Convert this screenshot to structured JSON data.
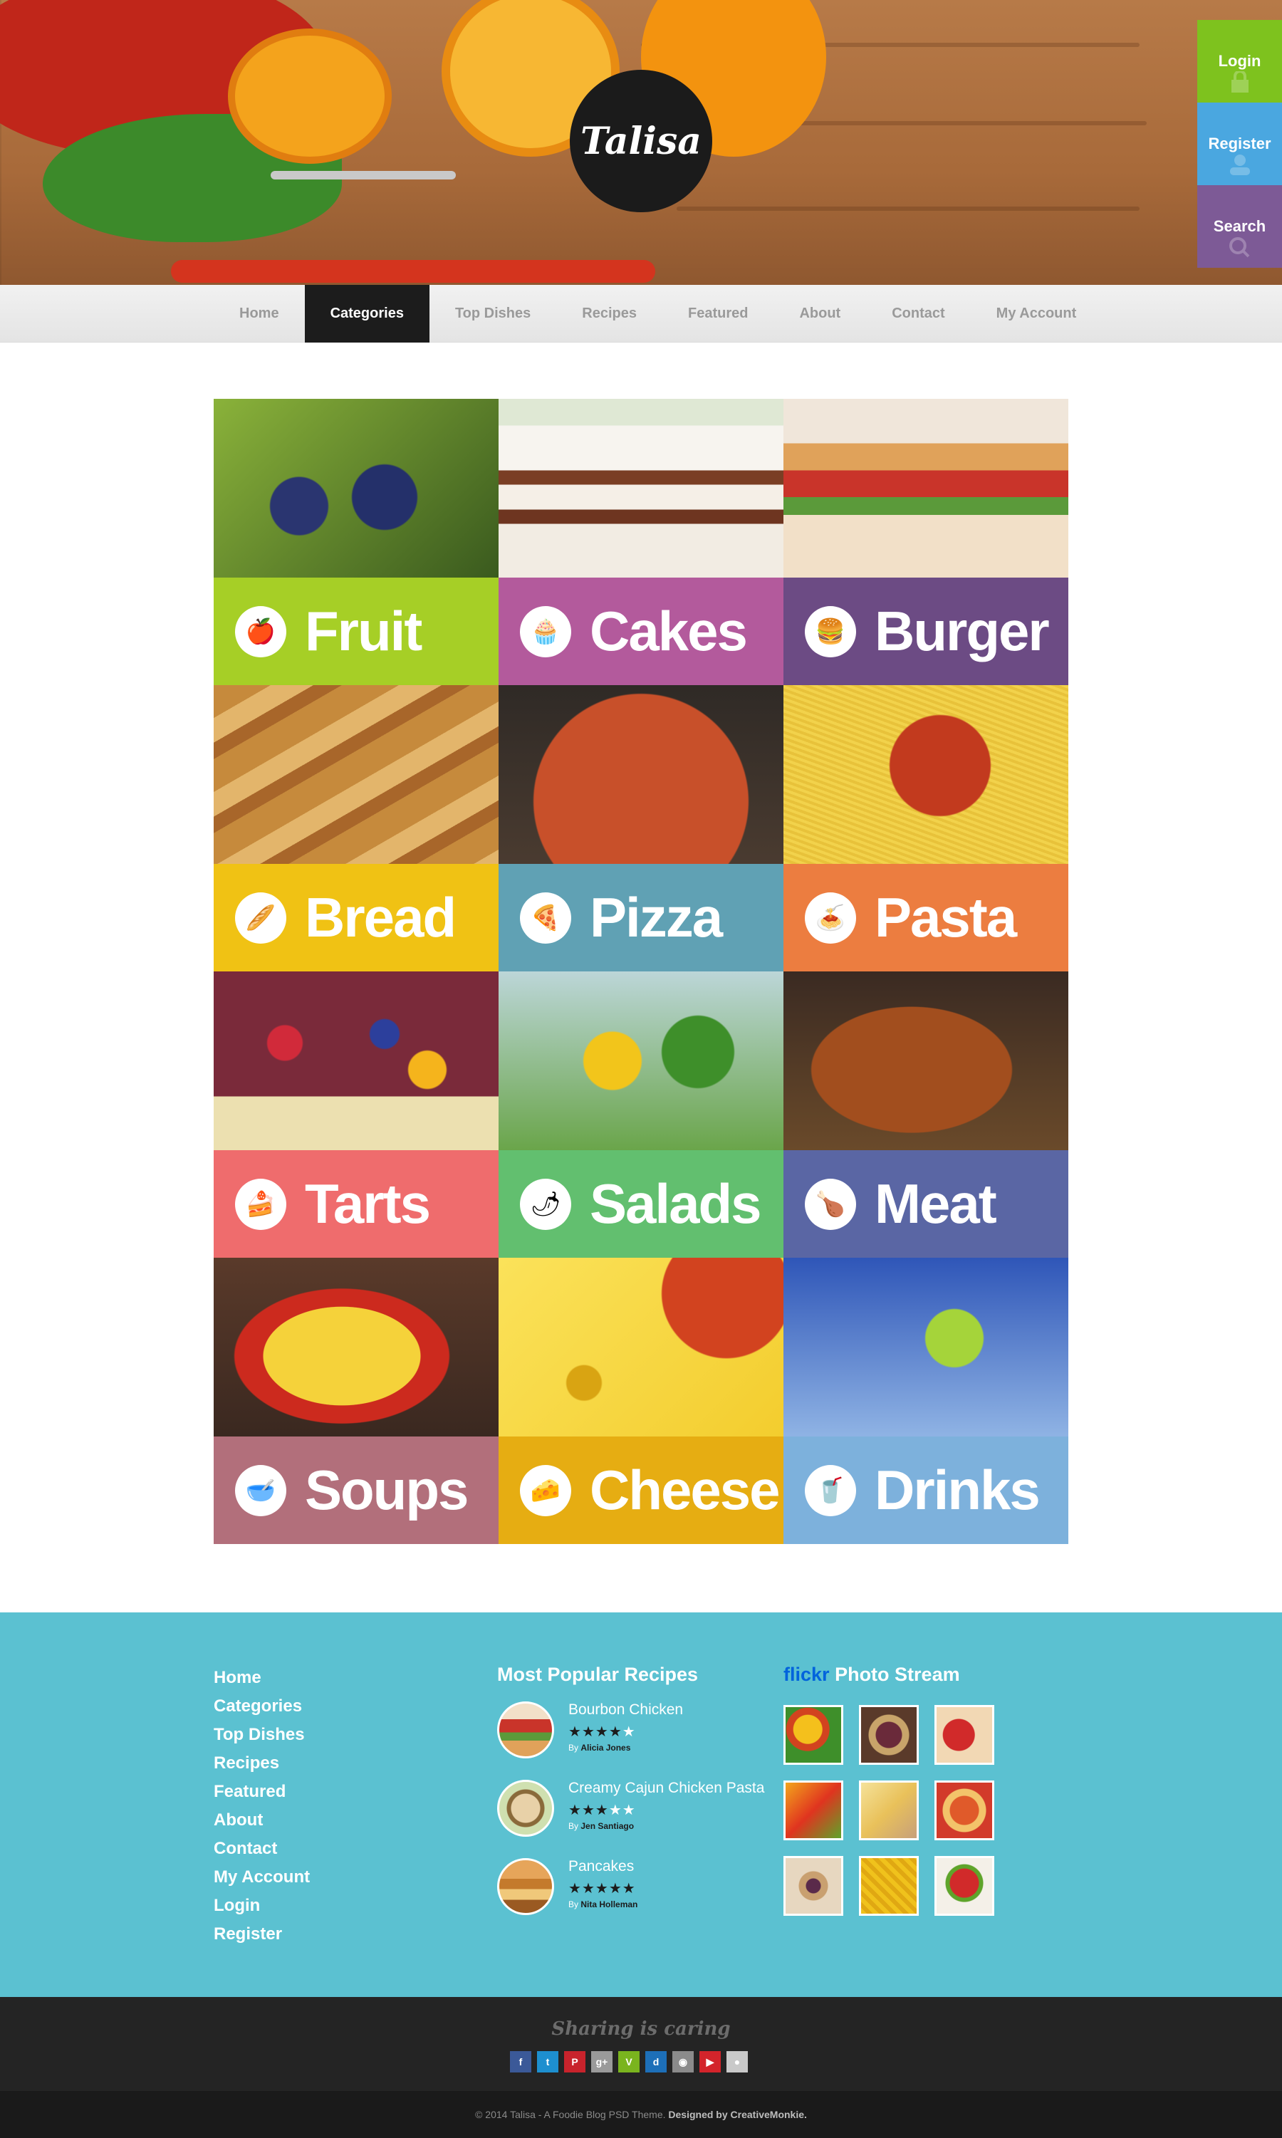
{
  "brand": {
    "name": "Talisa"
  },
  "side_actions": [
    {
      "key": "login",
      "label": "Login",
      "color": "#7ec21e"
    },
    {
      "key": "register",
      "label": "Register",
      "color": "#4aa7e0"
    },
    {
      "key": "search",
      "label": "Search",
      "color": "#7d5a96"
    }
  ],
  "nav": {
    "items": [
      "Home",
      "Categories",
      "Top Dishes",
      "Recipes",
      "Featured",
      "About",
      "Contact",
      "My Account"
    ],
    "active": "Categories"
  },
  "categories": [
    {
      "label": "Fruit",
      "icon": "apple-icon",
      "color": "#a6cf26"
    },
    {
      "label": "Cakes",
      "icon": "cupcake-icon",
      "color": "#b35a9c"
    },
    {
      "label": "Burger",
      "icon": "burger-icon",
      "color": "#6c4b84"
    },
    {
      "label": "Bread",
      "icon": "bread-icon",
      "color": "#f0c214"
    },
    {
      "label": "Pizza",
      "icon": "pizza-icon",
      "color": "#60a1b4"
    },
    {
      "label": "Pasta",
      "icon": "pasta-icon",
      "color": "#ec7d40"
    },
    {
      "label": "Tarts",
      "icon": "cake-slice-icon",
      "color": "#ef6c6d"
    },
    {
      "label": "Salads",
      "icon": "chili-icon",
      "color": "#62bf6f"
    },
    {
      "label": "Meat",
      "icon": "drumstick-icon",
      "color": "#5a66a4"
    },
    {
      "label": "Soups",
      "icon": "bowl-icon",
      "color": "#b26f7b"
    },
    {
      "label": "Cheese",
      "icon": "cheese-icon",
      "color": "#e6ad12"
    },
    {
      "label": "Drinks",
      "icon": "cup-icon",
      "color": "#7db1dc"
    }
  ],
  "footer": {
    "links": [
      "Home",
      "Categories",
      "Top Dishes",
      "Recipes",
      "Featured",
      "About",
      "Contact",
      "My Account",
      "Login",
      "Register"
    ],
    "popular_title": "Most Popular Recipes",
    "recipes": [
      {
        "title": "Bourbon Chicken",
        "rating": 4,
        "by_prefix": "By",
        "author": "Alicia Jones"
      },
      {
        "title": "Creamy Cajun Chicken Pasta",
        "rating": 3,
        "by_prefix": "By",
        "author": "Jen Santiago"
      },
      {
        "title": "Pancakes",
        "rating": 5,
        "by_prefix": "By",
        "author": "Nita Holleman"
      }
    ],
    "flickr_brand": "flickr",
    "flickr_title": "Photo Stream"
  },
  "social": {
    "tagline": "Sharing is caring",
    "icons": [
      {
        "name": "facebook-icon",
        "glyph": "f",
        "color": "#3b5998"
      },
      {
        "name": "twitter-icon",
        "glyph": "t",
        "color": "#1d8fcf"
      },
      {
        "name": "pinterest-icon",
        "glyph": "P",
        "color": "#c8232c"
      },
      {
        "name": "google-plus-icon",
        "glyph": "g+",
        "color": "#9a9a9a"
      },
      {
        "name": "vimeo-icon",
        "glyph": "V",
        "color": "#7ab41e"
      },
      {
        "name": "digg-icon",
        "glyph": "d",
        "color": "#1d6fb8"
      },
      {
        "name": "instagram-icon",
        "glyph": "◉",
        "color": "#8b8b8b"
      },
      {
        "name": "youtube-icon",
        "glyph": "▶",
        "color": "#d3242b"
      },
      {
        "name": "flickr-icon",
        "glyph": "●",
        "color": "#c9c9c9"
      }
    ]
  },
  "copyright": {
    "text": "© 2014 Talisa - A Foodie Blog PSD Theme.",
    "credit": "Designed by CreativeMonkie."
  }
}
